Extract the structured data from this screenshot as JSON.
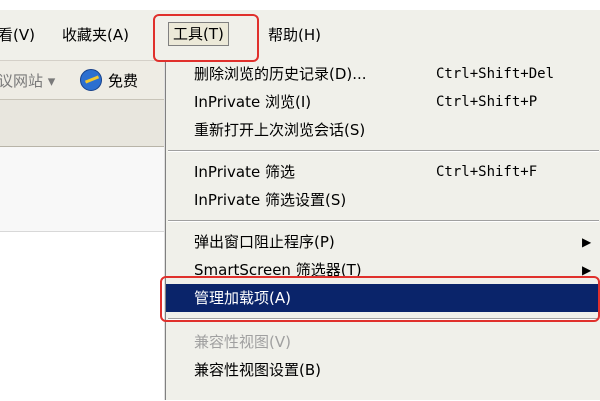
{
  "menubar": {
    "items": [
      {
        "label": "看(V)"
      },
      {
        "label": "收藏夹(A)"
      },
      {
        "label": "工具(T)"
      },
      {
        "label": "帮助(H)"
      }
    ]
  },
  "favorites_bar": {
    "suggested_sites": "议网站 ▾",
    "free_label": "免费"
  },
  "tools_menu": {
    "items": [
      {
        "label": "删除浏览的历史记录(D)...",
        "shortcut": "Ctrl+Shift+Del"
      },
      {
        "label": "InPrivate 浏览(I)",
        "shortcut": "Ctrl+Shift+P"
      },
      {
        "label": "重新打开上次浏览会话(S)",
        "shortcut": ""
      },
      {
        "label": "InPrivate 筛选",
        "shortcut": "Ctrl+Shift+F"
      },
      {
        "label": "InPrivate 筛选设置(S)",
        "shortcut": ""
      },
      {
        "label": "弹出窗口阻止程序(P)",
        "shortcut": "",
        "submenu": "▶"
      },
      {
        "label": "SmartScreen 筛选器(T)",
        "shortcut": "",
        "submenu": "▶"
      },
      {
        "label": "管理加载项(A)",
        "shortcut": ""
      },
      {
        "label": "兼容性视图(V)",
        "shortcut": ""
      },
      {
        "label": "兼容性视图设置(B)",
        "shortcut": ""
      }
    ]
  },
  "colors": {
    "highlight": "#0a246a",
    "annotation": "#e0302c"
  }
}
